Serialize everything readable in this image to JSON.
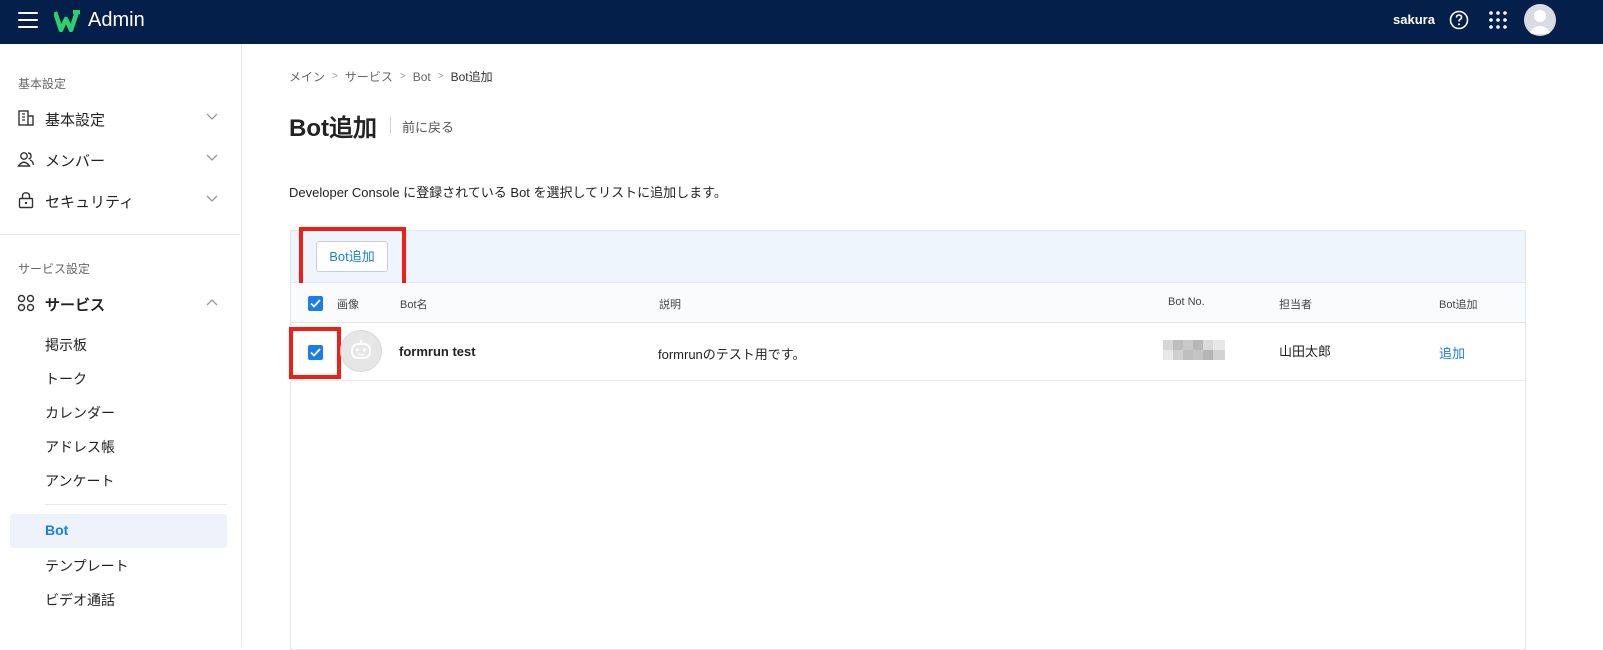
{
  "header": {
    "title": "Admin",
    "username": "sakura"
  },
  "sidebar": {
    "section1_title": "基本設定",
    "section2_title": "サービス設定",
    "items": [
      {
        "label": "基本設定",
        "icon": "building-icon"
      },
      {
        "label": "メンバー",
        "icon": "members-icon"
      },
      {
        "label": "セキュリティ",
        "icon": "lock-icon"
      },
      {
        "label": "サービス",
        "icon": "apps-icon"
      }
    ],
    "sub_items": [
      "掲示板",
      "トーク",
      "カレンダー",
      "アドレス帳",
      "アンケート",
      "Bot",
      "テンプレート",
      "ビデオ通話"
    ],
    "active_sub": "Bot"
  },
  "breadcrumb": [
    "メイン",
    "サービス",
    "Bot",
    "Bot追加"
  ],
  "page": {
    "title": "Bot追加",
    "back_label": "前に戻る",
    "description": "Developer Console に登録されている Bot を選択してリストに追加します。"
  },
  "toolbar": {
    "add_label": "Bot追加"
  },
  "table": {
    "columns": [
      "画像",
      "Bot名",
      "説明",
      "Bot No.",
      "担当者",
      "Bot追加"
    ],
    "rows": [
      {
        "checked": true,
        "name": "formrun test",
        "description": "formrunのテスト用です。",
        "bot_no": "",
        "owner": "山田太郎",
        "action": "追加"
      }
    ]
  },
  "colors": {
    "topbar": "#04204a",
    "accent": "#1a7ee6",
    "highlight": "#f01e16",
    "logo": "#2bd26b"
  }
}
